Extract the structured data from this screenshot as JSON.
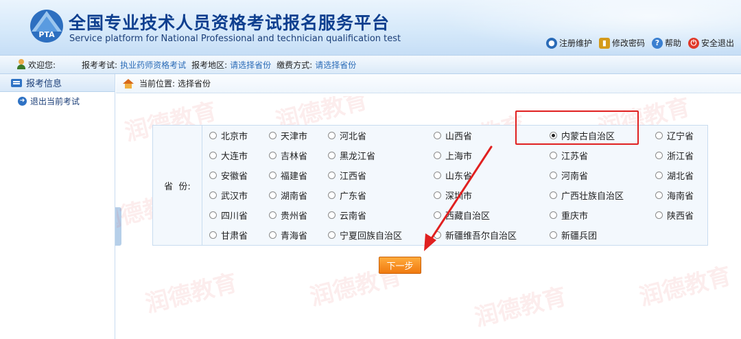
{
  "header": {
    "title_cn": "全国专业技术人员资格考试报名服务平台",
    "title_en": "Service platform for National Professional and technician qualification test",
    "logo_text": "PTA",
    "links": [
      {
        "label": "注册维护",
        "icon": "globe-icon",
        "color": "#2a6bb7"
      },
      {
        "label": "修改密码",
        "icon": "lock-icon",
        "color": "#d49a1a"
      },
      {
        "label": "帮助",
        "icon": "help-icon",
        "color": "#3a7fd0"
      },
      {
        "label": "安全退出",
        "icon": "power-icon",
        "color": "#e03a2a"
      }
    ]
  },
  "infobar": {
    "welcome": "欢迎您:",
    "exam_label": "报考考试:",
    "exam_value": "执业药师资格考试",
    "region_label": "报考地区:",
    "region_value": "请选择省份",
    "pay_label": "缴费方式:",
    "pay_value": "请选择省份"
  },
  "sidebar": {
    "header": "报考信息",
    "items": [
      {
        "label": "退出当前考试"
      }
    ]
  },
  "breadcrumb": {
    "label": "当前位置:",
    "value": "选择省份"
  },
  "form": {
    "province_label": "省  份:",
    "selected": "内蒙古自治区",
    "rows": [
      [
        "北京市",
        "天津市",
        "河北省",
        "山西省",
        "内蒙古自治区",
        "辽宁省"
      ],
      [
        "大连市",
        "吉林省",
        "黑龙江省",
        "上海市",
        "江苏省",
        "浙江省"
      ],
      [
        "安徽省",
        "福建省",
        "江西省",
        "山东省",
        "河南省",
        "湖北省"
      ],
      [
        "武汉市",
        "湖南省",
        "广东省",
        "深圳市",
        "广西壮族自治区",
        "海南省"
      ],
      [
        "四川省",
        "贵州省",
        "云南省",
        "西藏自治区",
        "重庆市",
        "陕西省"
      ],
      [
        "甘肃省",
        "青海省",
        "宁夏回族自治区",
        "新疆维吾尔自治区",
        "新疆兵团"
      ]
    ],
    "next_button": "下一步"
  },
  "watermark": "润德教育",
  "colors": {
    "accent": "#2a6bb7",
    "highlight": "#e02020",
    "button": "#f07a10"
  }
}
